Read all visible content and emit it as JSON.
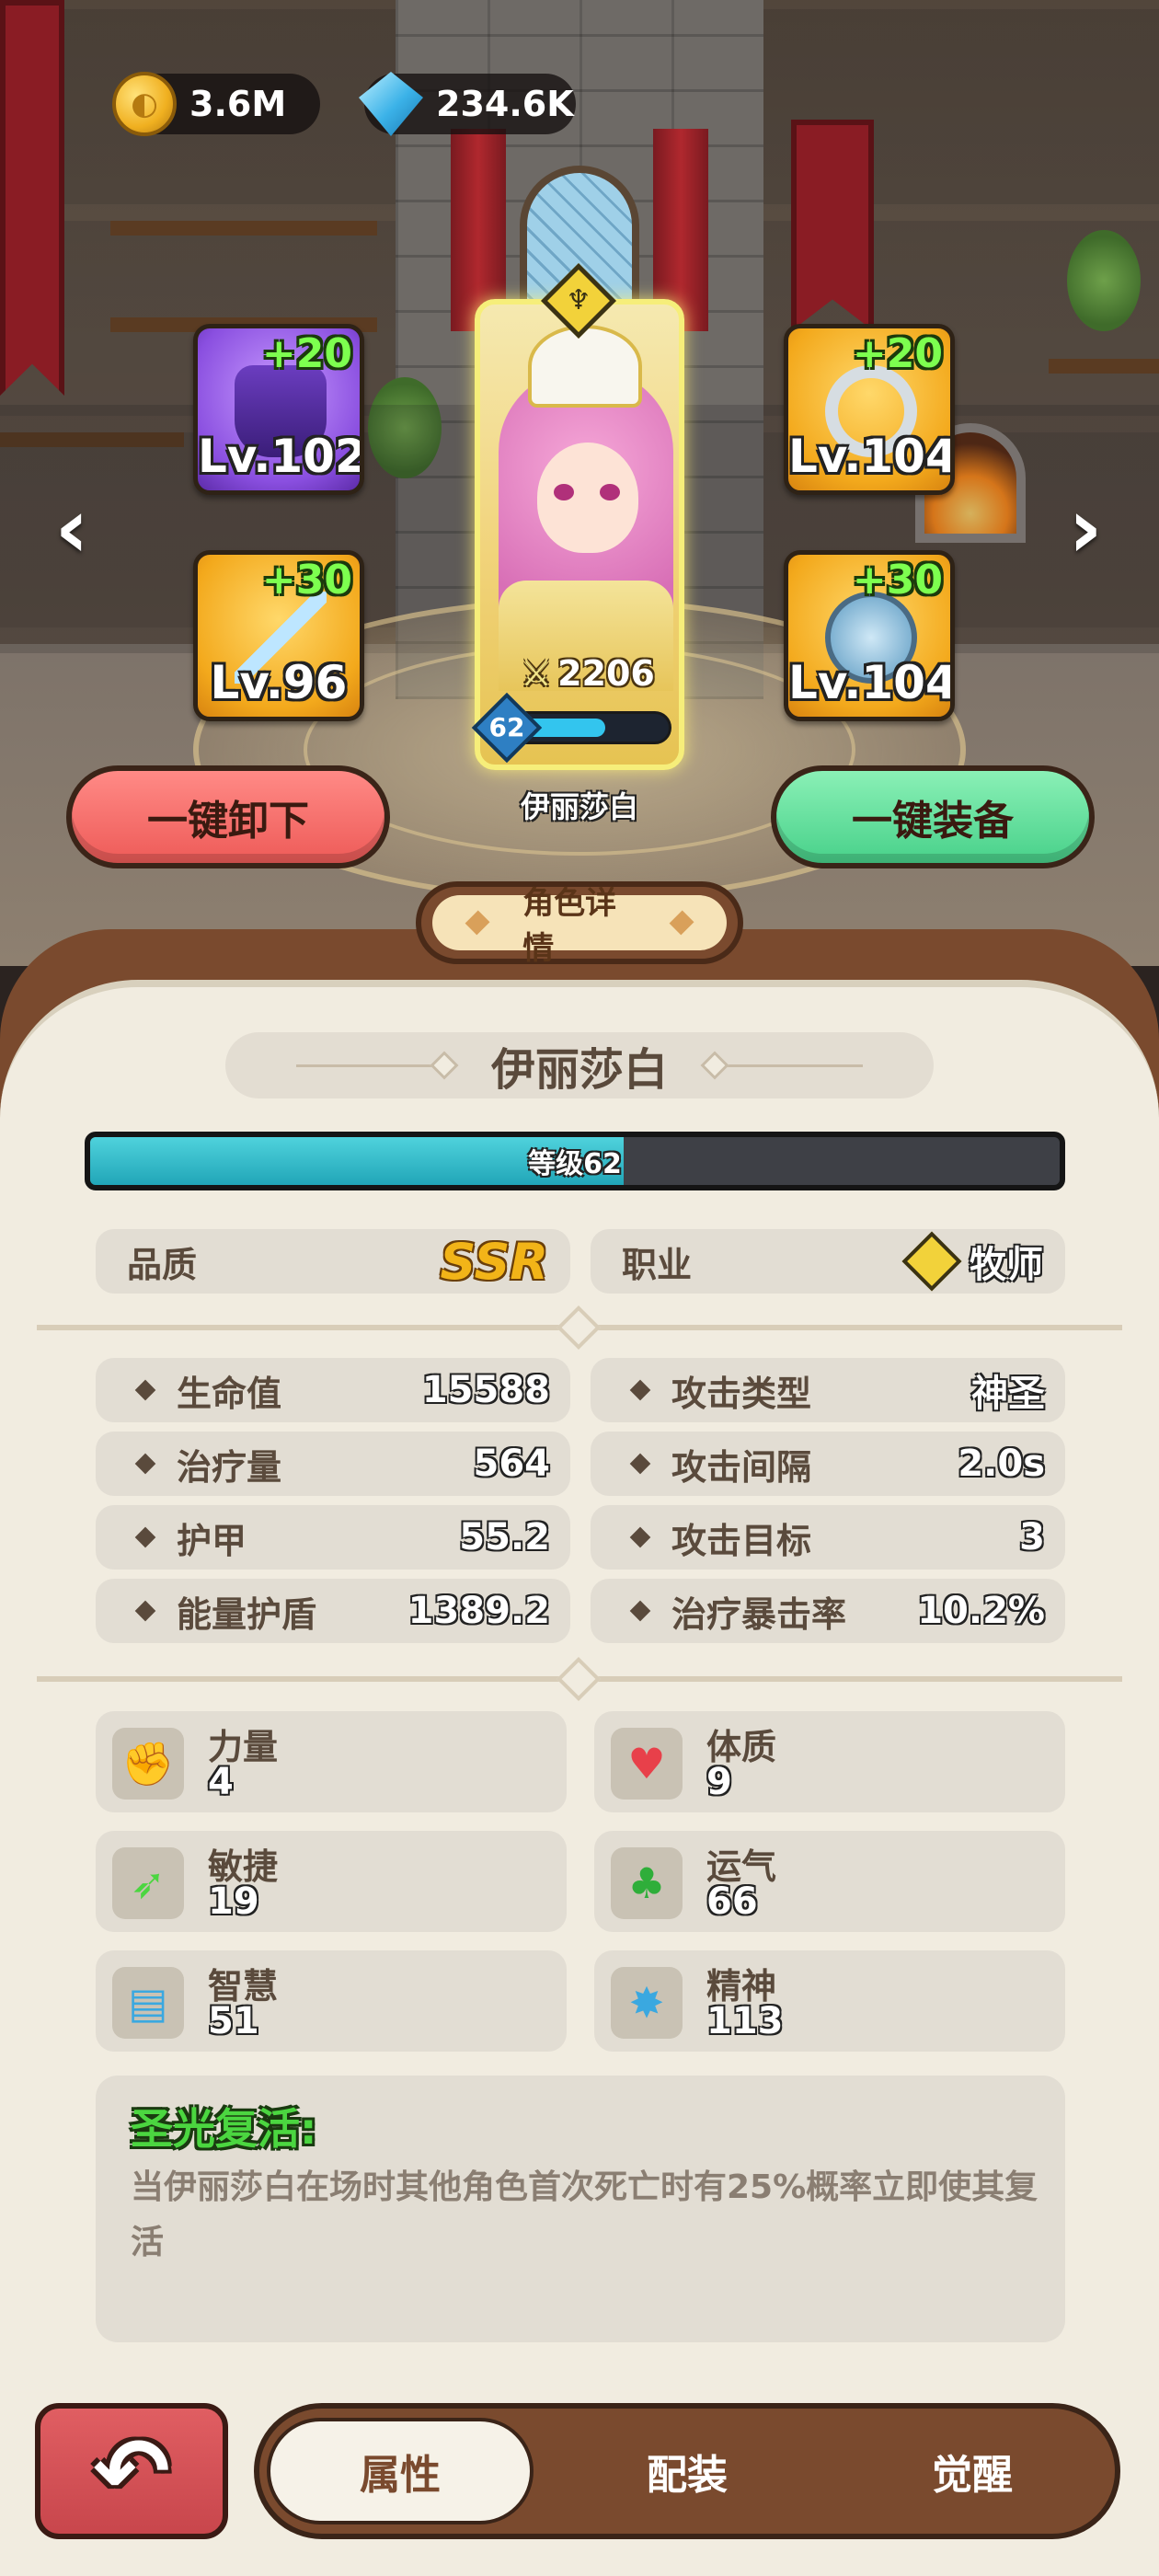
{
  "currency": {
    "gold": "3.6M",
    "gems": "234.6K"
  },
  "equipment": [
    {
      "slot": "top-left",
      "bonus": "+20",
      "level": "Lv.102",
      "rarity": "purple",
      "icon": "robe-icon"
    },
    {
      "slot": "bottom-left",
      "bonus": "+30",
      "level": "Lv.96",
      "rarity": "gold",
      "icon": "staff-icon"
    },
    {
      "slot": "top-right",
      "bonus": "+20",
      "level": "Lv.104",
      "rarity": "gold",
      "icon": "ring-icon"
    },
    {
      "slot": "bottom-right",
      "bonus": "+30",
      "level": "Lv.104",
      "rarity": "gold",
      "icon": "shield-icon"
    }
  ],
  "hero": {
    "name": "伊丽莎白",
    "power": "2206",
    "level": "62",
    "level_progress": 0.59
  },
  "actions": {
    "unequip_all": "一键卸下",
    "equip_all": "一键装备"
  },
  "detail": {
    "tab_title": "角色详情",
    "name": "伊丽莎白",
    "xp_label": "等级62",
    "xp_progress": 0.55,
    "quality_label": "品质",
    "quality_value": "SSR",
    "role_label": "职业",
    "role_value": "牧师",
    "stats": [
      {
        "label": "生命值",
        "value": "15588"
      },
      {
        "label": "攻击类型",
        "value": "神圣"
      },
      {
        "label": "治疗量",
        "value": "564"
      },
      {
        "label": "攻击间隔",
        "value": "2.0s"
      },
      {
        "label": "护甲",
        "value": "55.2"
      },
      {
        "label": "攻击目标",
        "value": "3"
      },
      {
        "label": "能量护盾",
        "value": "1389.2"
      },
      {
        "label": "治疗暴击率",
        "value": "10.2%"
      }
    ],
    "attributes": [
      {
        "label": "力量",
        "value": "4",
        "icon": "fist-icon",
        "color": "#e8404a"
      },
      {
        "label": "体质",
        "value": "9",
        "icon": "heart-icon",
        "color": "#e8404a"
      },
      {
        "label": "敏捷",
        "value": "19",
        "icon": "wing-icon",
        "color": "#4bd640"
      },
      {
        "label": "运气",
        "value": "66",
        "icon": "clover-icon",
        "color": "#2fae3a"
      },
      {
        "label": "智慧",
        "value": "51",
        "icon": "book-icon",
        "color": "#3aa8e0"
      },
      {
        "label": "精神",
        "value": "113",
        "icon": "spark-icon",
        "color": "#3aa8e0"
      }
    ],
    "skill": {
      "title": "圣光复活:",
      "desc": "当伊丽莎白在场时其他角色首次死亡时有25%概率立即使其复活"
    }
  },
  "bottom_tabs": [
    {
      "label": "属性",
      "active": true
    },
    {
      "label": "配装",
      "active": false
    },
    {
      "label": "觉醒",
      "active": false
    }
  ]
}
